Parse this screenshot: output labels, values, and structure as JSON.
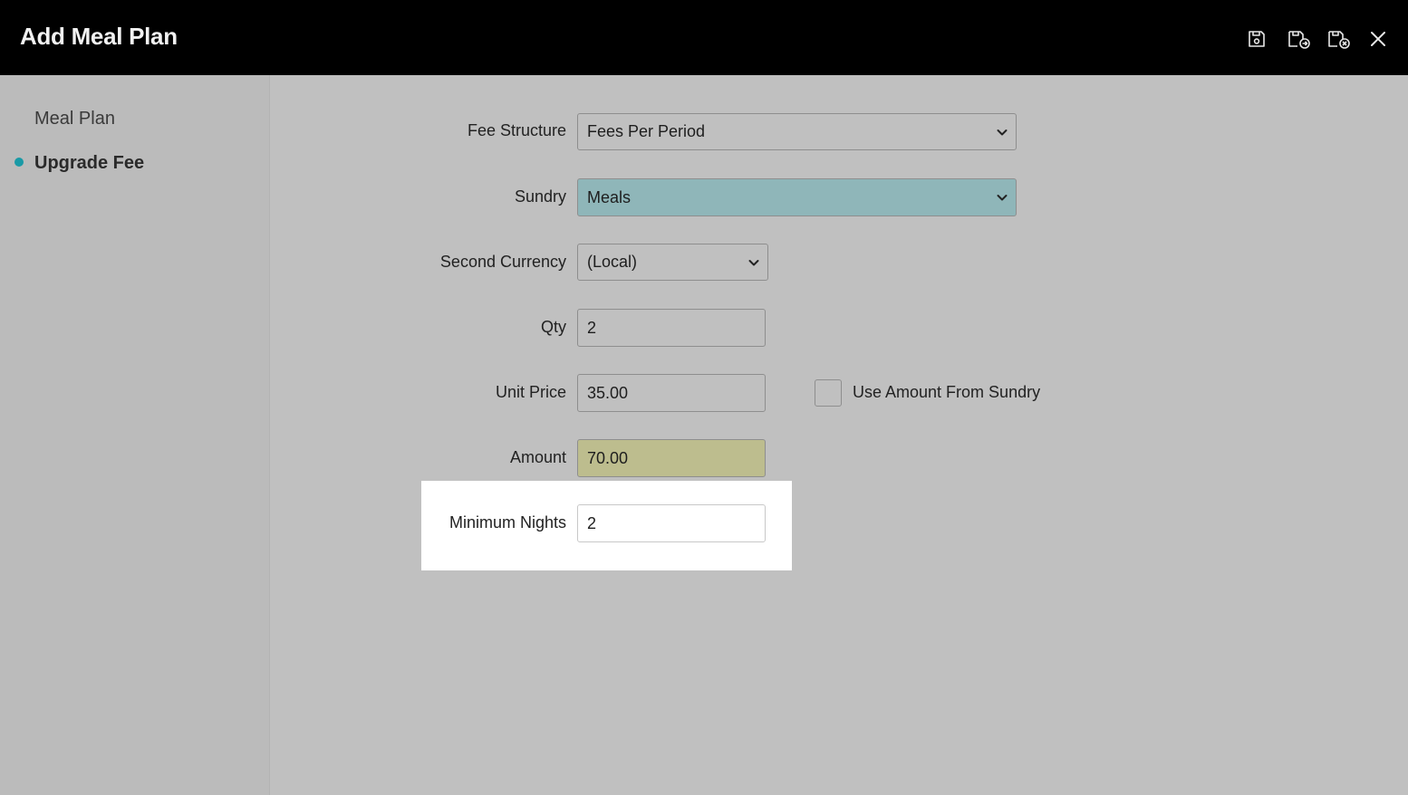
{
  "header": {
    "title": "Add Meal Plan"
  },
  "sidebar": {
    "items": [
      {
        "label": "Meal Plan",
        "active": false
      },
      {
        "label": "Upgrade Fee",
        "active": true
      }
    ]
  },
  "form": {
    "fee_structure": {
      "label": "Fee Structure",
      "value": "Fees Per Period"
    },
    "sundry": {
      "label": "Sundry",
      "value": "Meals"
    },
    "second_currency": {
      "label": "Second Currency",
      "value": "(Local)"
    },
    "qty": {
      "label": "Qty",
      "value": "2"
    },
    "unit_price": {
      "label": "Unit Price",
      "value": "35.00"
    },
    "use_amount_from_sundry": {
      "label": "Use Amount From Sundry",
      "checked": false
    },
    "amount": {
      "label": "Amount",
      "value": "70.00"
    },
    "minimum_nights": {
      "label": "Minimum Nights",
      "value": "2"
    }
  },
  "colors": {
    "header_bg": "#000000",
    "accent_dot": "#1a9aa6",
    "sundry_bg": "#8fb6b9",
    "amount_bg": "#bdbd8e",
    "highlight_bg": "#ffffff"
  },
  "icons": [
    "save-icon",
    "save-and-next-icon",
    "save-and-close-icon",
    "close-icon"
  ]
}
